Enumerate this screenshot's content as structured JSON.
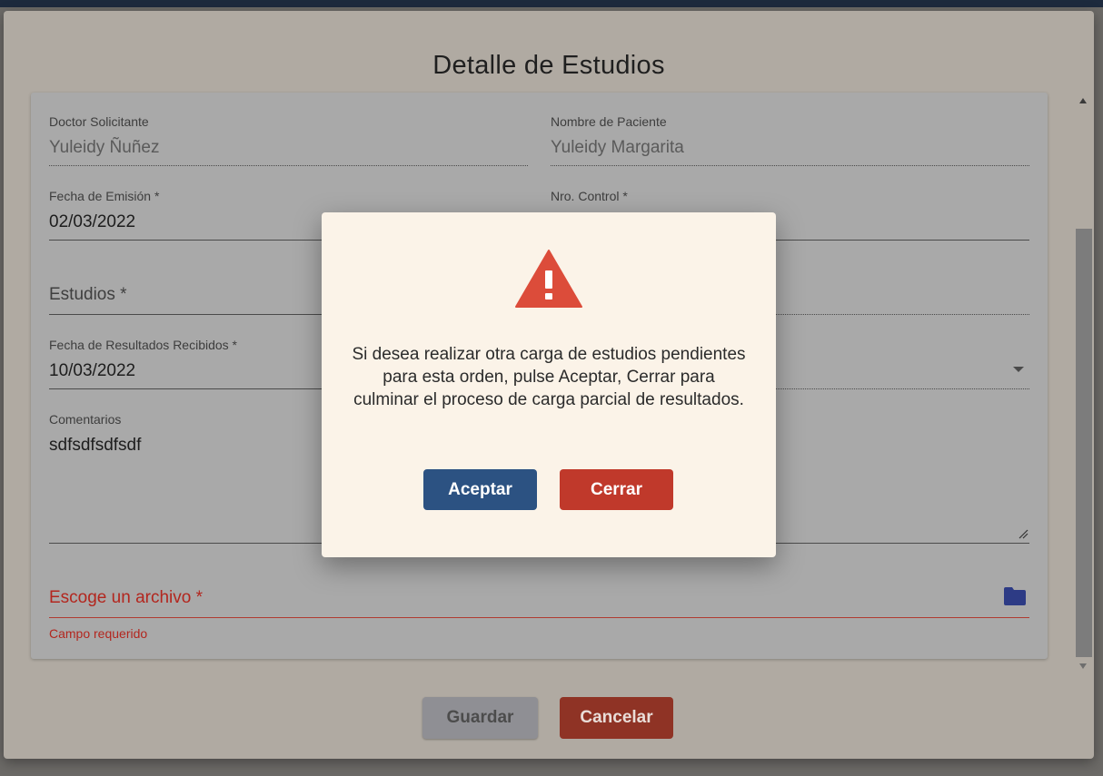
{
  "modal": {
    "title": "Detalle de Estudios"
  },
  "form": {
    "doctor": {
      "label": "Doctor Solicitante",
      "value": "Yuleidy Ñuñez"
    },
    "paciente": {
      "label": "Nombre de Paciente",
      "value": "Yuleidy Margarita"
    },
    "fecha_emision": {
      "label": "Fecha de Emisión *",
      "value": "02/03/2022"
    },
    "nro_control": {
      "label": "Nro. Control *",
      "value": ""
    },
    "estudios": {
      "placeholder": "Estudios *"
    },
    "fecha_resultados": {
      "label": "Fecha de Resultados Recibidos *",
      "value": "10/03/2022"
    },
    "comentarios": {
      "label": "Comentarios",
      "value": "sdfsdfsdfsdf"
    },
    "archivo": {
      "placeholder": "Escoge un archivo *",
      "error": "Campo requerido",
      "icon": "folder-icon"
    }
  },
  "footer": {
    "guardar_label": "Guardar",
    "cancelar_label": "Cancelar"
  },
  "dialog": {
    "icon": "warning-icon",
    "message": "Si desea realizar otra carga de estudios pendientes para esta orden, pulse Aceptar, Cerrar para culminar el proceso de carga parcial de resultados.",
    "aceptar_label": "Aceptar",
    "cerrar_label": "Cerrar"
  },
  "colors": {
    "primary": "#2c5282",
    "danger": "#c0392b",
    "warning": "#dc4c3a",
    "error_text": "#b3261e"
  }
}
